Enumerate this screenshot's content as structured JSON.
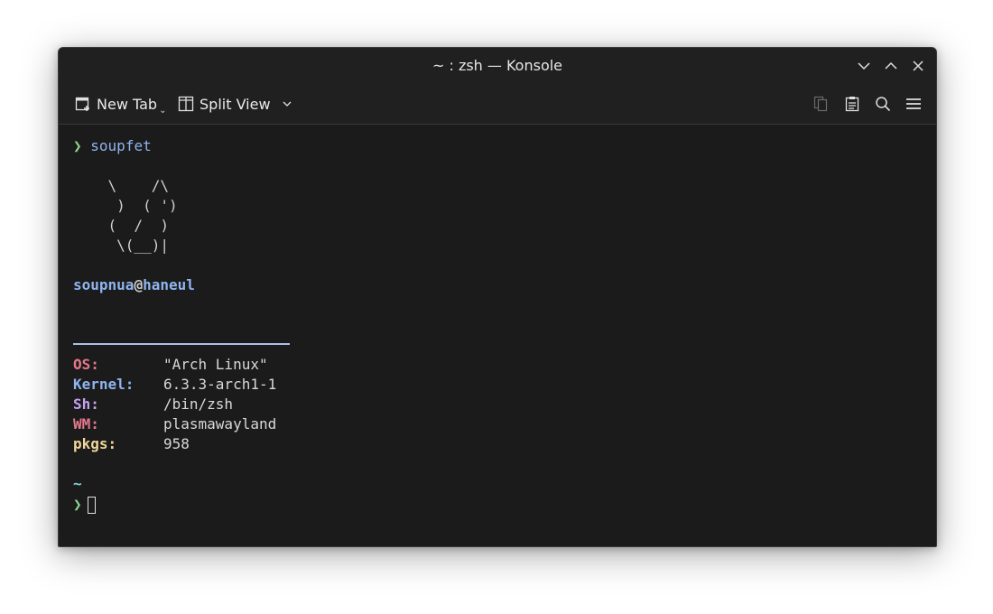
{
  "window": {
    "title": "~ : zsh — Konsole"
  },
  "toolbar": {
    "new_tab_label": "New Tab",
    "split_view_label": "Split View"
  },
  "terminal": {
    "prompt_symbol": "❯",
    "command": "soupfet",
    "ascii_art": [
      "    \\    /\\",
      "     )  ( ')",
      "    (  /  )",
      "     \\(__)|"
    ],
    "user": "soupnua",
    "at": "@",
    "host": "haneul",
    "info": [
      {
        "label": "OS:",
        "value": "\"Arch Linux\"",
        "color": "#e5788c"
      },
      {
        "label": "Kernel:",
        "value": "6.3.3-arch1-1",
        "color": "#8fb4ef"
      },
      {
        "label": "Sh:",
        "value": "/bin/zsh",
        "color": "#c4a3ef"
      },
      {
        "label": "WM:",
        "value": "plasmawayland",
        "color": "#e5788c"
      },
      {
        "label": "pkgs:",
        "value": "958",
        "color": "#f0d69a"
      }
    ],
    "cwd": "~",
    "cwd_color": "#7fd4d4"
  },
  "icons": {
    "new_tab": "new-tab-icon",
    "split_view": "split-view-icon",
    "copy": "copy-icon",
    "paste": "paste-icon",
    "search": "search-icon",
    "menu": "hamburger-menu-icon",
    "minimize": "chevron-down-icon",
    "maximize": "chevron-up-icon",
    "close": "close-icon"
  }
}
